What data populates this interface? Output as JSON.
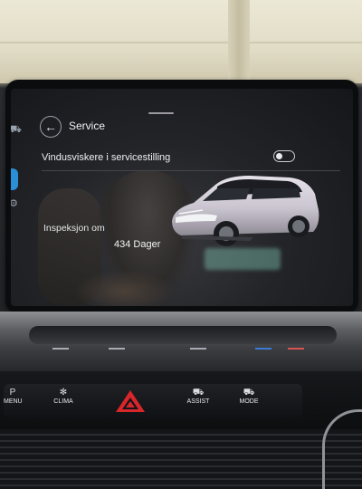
{
  "screen": {
    "page_title": "Service",
    "toggle_row": {
      "label": "Vindusviskere i servicestilling",
      "state": "off"
    },
    "inspection": {
      "label": "Inspeksjon om",
      "value": "434 Dager"
    },
    "car_color": "#c9c4cf"
  },
  "buttons": {
    "menu": {
      "label": "MENU",
      "icon": "p-icon"
    },
    "clima": {
      "label": "CLIMA",
      "icon": "fan-icon"
    },
    "hazard": {
      "icon": "hazard-triangle-icon",
      "color": "#d8262a"
    },
    "assist": {
      "label": "ASSIST",
      "icon": "assist-car-icon"
    },
    "mode": {
      "label": "MODE",
      "icon": "mode-car-icon"
    }
  },
  "glyphs": {
    "back": "←",
    "menu": "P",
    "clima": "✻",
    "assist": "⛟",
    "mode": "⛟"
  }
}
